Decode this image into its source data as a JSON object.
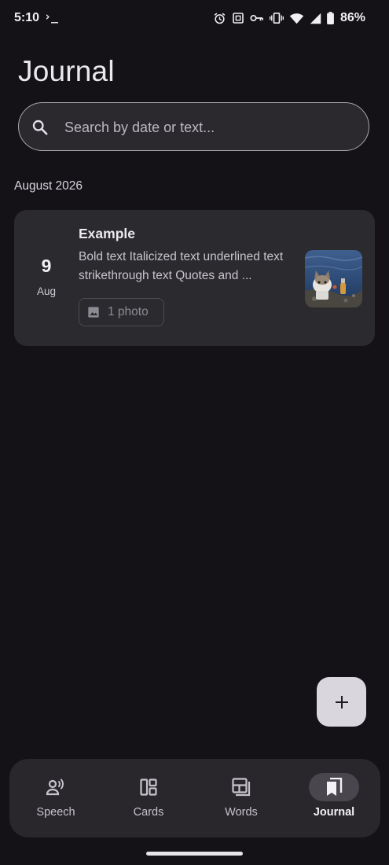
{
  "status_bar": {
    "time": "5:10",
    "terminal_glyph": "›_",
    "battery_percent": "86%",
    "icons": [
      "alarm-icon",
      "nfc-icon",
      "vpn-key-icon",
      "vibrate-icon",
      "wifi-icon",
      "signal-icon",
      "battery-icon"
    ]
  },
  "header": {
    "title": "Journal"
  },
  "search": {
    "placeholder": "Search by date or text..."
  },
  "journal": {
    "sections": [
      {
        "heading": "August 2026",
        "entries": [
          {
            "day": "9",
            "month": "Aug",
            "title": "Example",
            "preview": "Bold text Italicized text underlined text strikethrough text Quotes and ...",
            "photo_label": "1 photo",
            "thumbnail_icon": "photo-thumbnail"
          }
        ]
      }
    ]
  },
  "fab": {
    "icon": "plus-icon"
  },
  "bottom_nav": {
    "items": [
      {
        "label": "Speech",
        "icon": "record-voice-icon",
        "active": false
      },
      {
        "label": "Cards",
        "icon": "dashboard-icon",
        "active": false
      },
      {
        "label": "Words",
        "icon": "library-icon",
        "active": false
      },
      {
        "label": "Journal",
        "icon": "bookmarks-icon",
        "active": true
      }
    ]
  },
  "colors": {
    "background": "#141217",
    "surface": "#2b2a2e",
    "nav_background": "#29272c",
    "active_indicator": "#49464d",
    "fab": "#d9d6dd",
    "text_primary": "#ece9ef"
  }
}
